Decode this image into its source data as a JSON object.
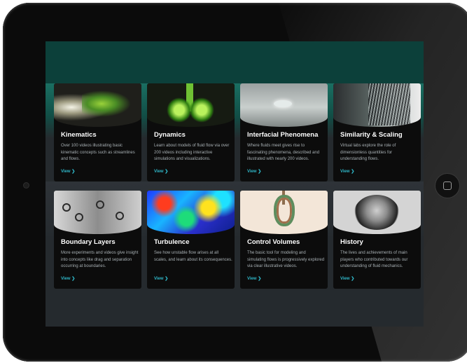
{
  "cards": [
    {
      "title": "Kinematics",
      "desc": "Over 100 videos illustrating basic kinematic concepts such as streamlines and flows.",
      "view": "View ❯",
      "icon": "kinematics-image"
    },
    {
      "title": "Dynamics",
      "desc": "Learn about models of fluid flow via over 200 videos including interactive simulations and visualizations.",
      "view": "View ❯",
      "icon": "dynamics-image"
    },
    {
      "title": "Interfacial Phenomena",
      "desc": "Where fluids meet gives rise to fascinating phenomena, described and illustrated with nearly 200 videos.",
      "view": "View ❯",
      "icon": "interfacial-image"
    },
    {
      "title": "Similarity & Scaling",
      "desc": "Virtual labs explore the role of dimensionless quantities for understanding flows.",
      "view": "View ❯",
      "icon": "similarity-image"
    },
    {
      "title": "Boundary Layers",
      "desc": "More experiments and videos give insight into concepts like drag and separation occurring at boundaries.",
      "view": "View ❯",
      "icon": "boundary-image"
    },
    {
      "title": "Turbulence",
      "desc": "See how unstable flow arises at all scales, and learn about its consequences.",
      "view": "View ❯",
      "icon": "turbulence-image"
    },
    {
      "title": "Control Volumes",
      "desc": "The basic tool for modeling and simulating flows is progressively explored via clear illustrative videos.",
      "view": "View ❯",
      "icon": "control-volumes-image"
    },
    {
      "title": "History",
      "desc": "The lives and achievements of main players who contributed towards our understanding of fluid mechanics.",
      "view": "View ❯",
      "icon": "history-image"
    }
  ],
  "colors": {
    "header": "#0c403a",
    "accent": "#2fb6c7",
    "card_bg": "#0c0c0c",
    "screen_bg": "#252a2e"
  }
}
